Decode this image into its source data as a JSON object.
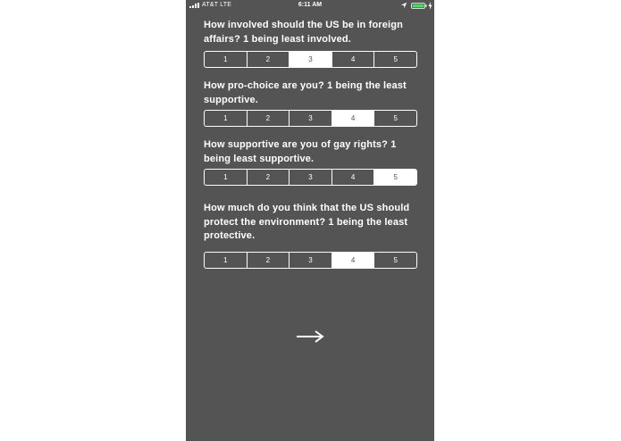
{
  "status_bar": {
    "carrier": "AT&T  LTE",
    "time": "6:11 AM",
    "icons": [
      "signal-icon",
      "location-icon",
      "battery-icon",
      "charge-icon"
    ]
  },
  "colors": {
    "background": "#545454",
    "foreground": "#ffffff",
    "battery": "#4cd964"
  },
  "questions": [
    {
      "text": "How involved should the US be in foreign affairs? 1 being least involved.",
      "options": [
        "1",
        "2",
        "3",
        "4",
        "5"
      ],
      "selected": "3"
    },
    {
      "text": "How pro-choice are you? 1 being the least supportive.",
      "options": [
        "1",
        "2",
        "3",
        "4",
        "5"
      ],
      "selected": "4"
    },
    {
      "text": "How supportive are you of gay rights? 1 being least supportive.",
      "options": [
        "1",
        "2",
        "3",
        "4",
        "5"
      ],
      "selected": "5"
    },
    {
      "text": "How much do you think that the US should protect the environment? 1 being the least protective.",
      "options": [
        "1",
        "2",
        "3",
        "4",
        "5"
      ],
      "selected": "4"
    }
  ],
  "next_button": {
    "icon": "arrow-right-icon"
  }
}
